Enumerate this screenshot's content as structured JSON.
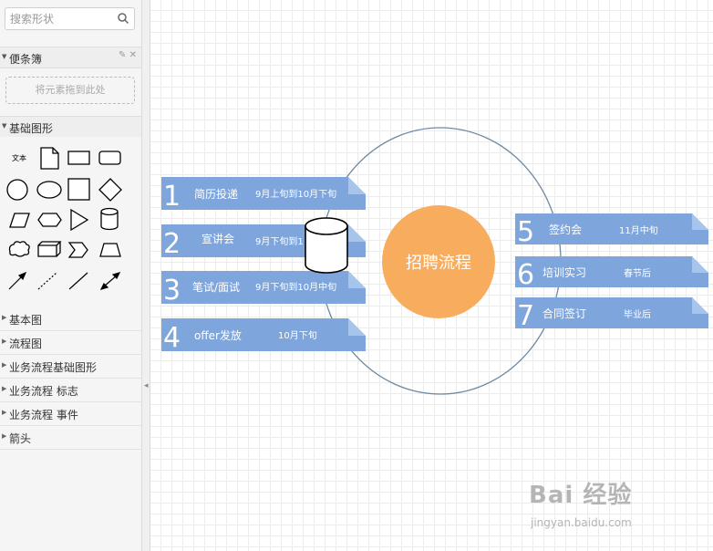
{
  "sidebar": {
    "search_placeholder": "搜索形状",
    "scratchpad": {
      "title": "便条簿",
      "drop_hint": "将元素拖到此处"
    },
    "basic_shapes": {
      "title": "基础图形",
      "text_shape_label": "文本"
    },
    "libraries": [
      {
        "label": "基本图"
      },
      {
        "label": "流程图"
      },
      {
        "label": "业务流程基础图形"
      },
      {
        "label": "业务流程 标志"
      },
      {
        "label": "业务流程 事件"
      },
      {
        "label": "箭头"
      }
    ]
  },
  "diagram": {
    "center_label": "招聘流程",
    "colors": {
      "ribbon": "#7ea6dc",
      "ribbon_fold": "#a7c4ea",
      "center": "#f8ad5e",
      "circle": "#6f8aa2"
    },
    "steps": [
      {
        "num": "1",
        "title": "简历投递",
        "date": "9月上旬到10月下旬"
      },
      {
        "num": "2",
        "title": "宣讲会",
        "date": "9月下旬到1"
      },
      {
        "num": "3",
        "title": "笔试/面试",
        "date": "9月下旬到10月中旬"
      },
      {
        "num": "4",
        "title": "offer发放",
        "date": "10月下旬"
      },
      {
        "num": "5",
        "title": "签约会",
        "date": "11月中旬"
      },
      {
        "num": "6",
        "title": "培训实习",
        "date": "春节后"
      },
      {
        "num": "7",
        "title": "合同签订",
        "date": "毕业后"
      }
    ]
  },
  "watermark": {
    "brand": "Bai 经验",
    "url": "jingyan.baidu.com"
  }
}
